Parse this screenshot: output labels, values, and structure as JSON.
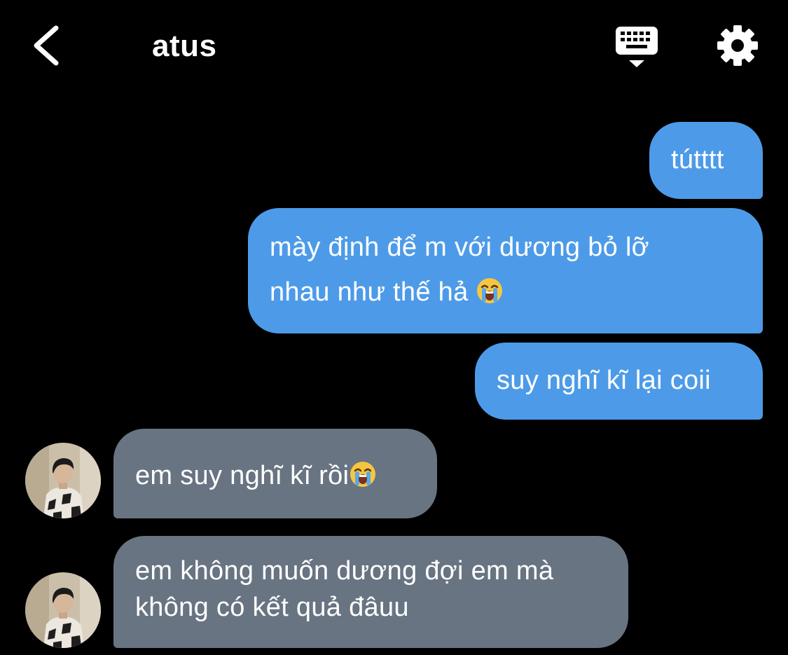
{
  "header": {
    "title": "atus",
    "back_icon": "chevron-left-icon",
    "keyboard_icon": "keyboard-icon",
    "settings_icon": "gear-icon"
  },
  "colors": {
    "background": "#000000",
    "outgoing_bubble": "#4d9be8",
    "incoming_bubble": "#687482",
    "text": "#ffffff"
  },
  "messages": [
    {
      "direction": "outgoing",
      "lines": [
        "tútttt"
      ]
    },
    {
      "direction": "outgoing",
      "lines": [
        "mày định để m với dương bỏ lỡ",
        "nhau như thế hả"
      ],
      "trailing_emoji": "loudly-crying-face"
    },
    {
      "direction": "outgoing",
      "lines": [
        "suy nghĩ kĩ lại coii"
      ]
    },
    {
      "direction": "incoming",
      "lines": [
        "em suy nghĩ kĩ rồi"
      ],
      "trailing_emoji": "loudly-crying-face"
    },
    {
      "direction": "incoming",
      "lines": [
        "em không muốn dương đợi em mà",
        "không có kết quả đâuu"
      ]
    }
  ]
}
